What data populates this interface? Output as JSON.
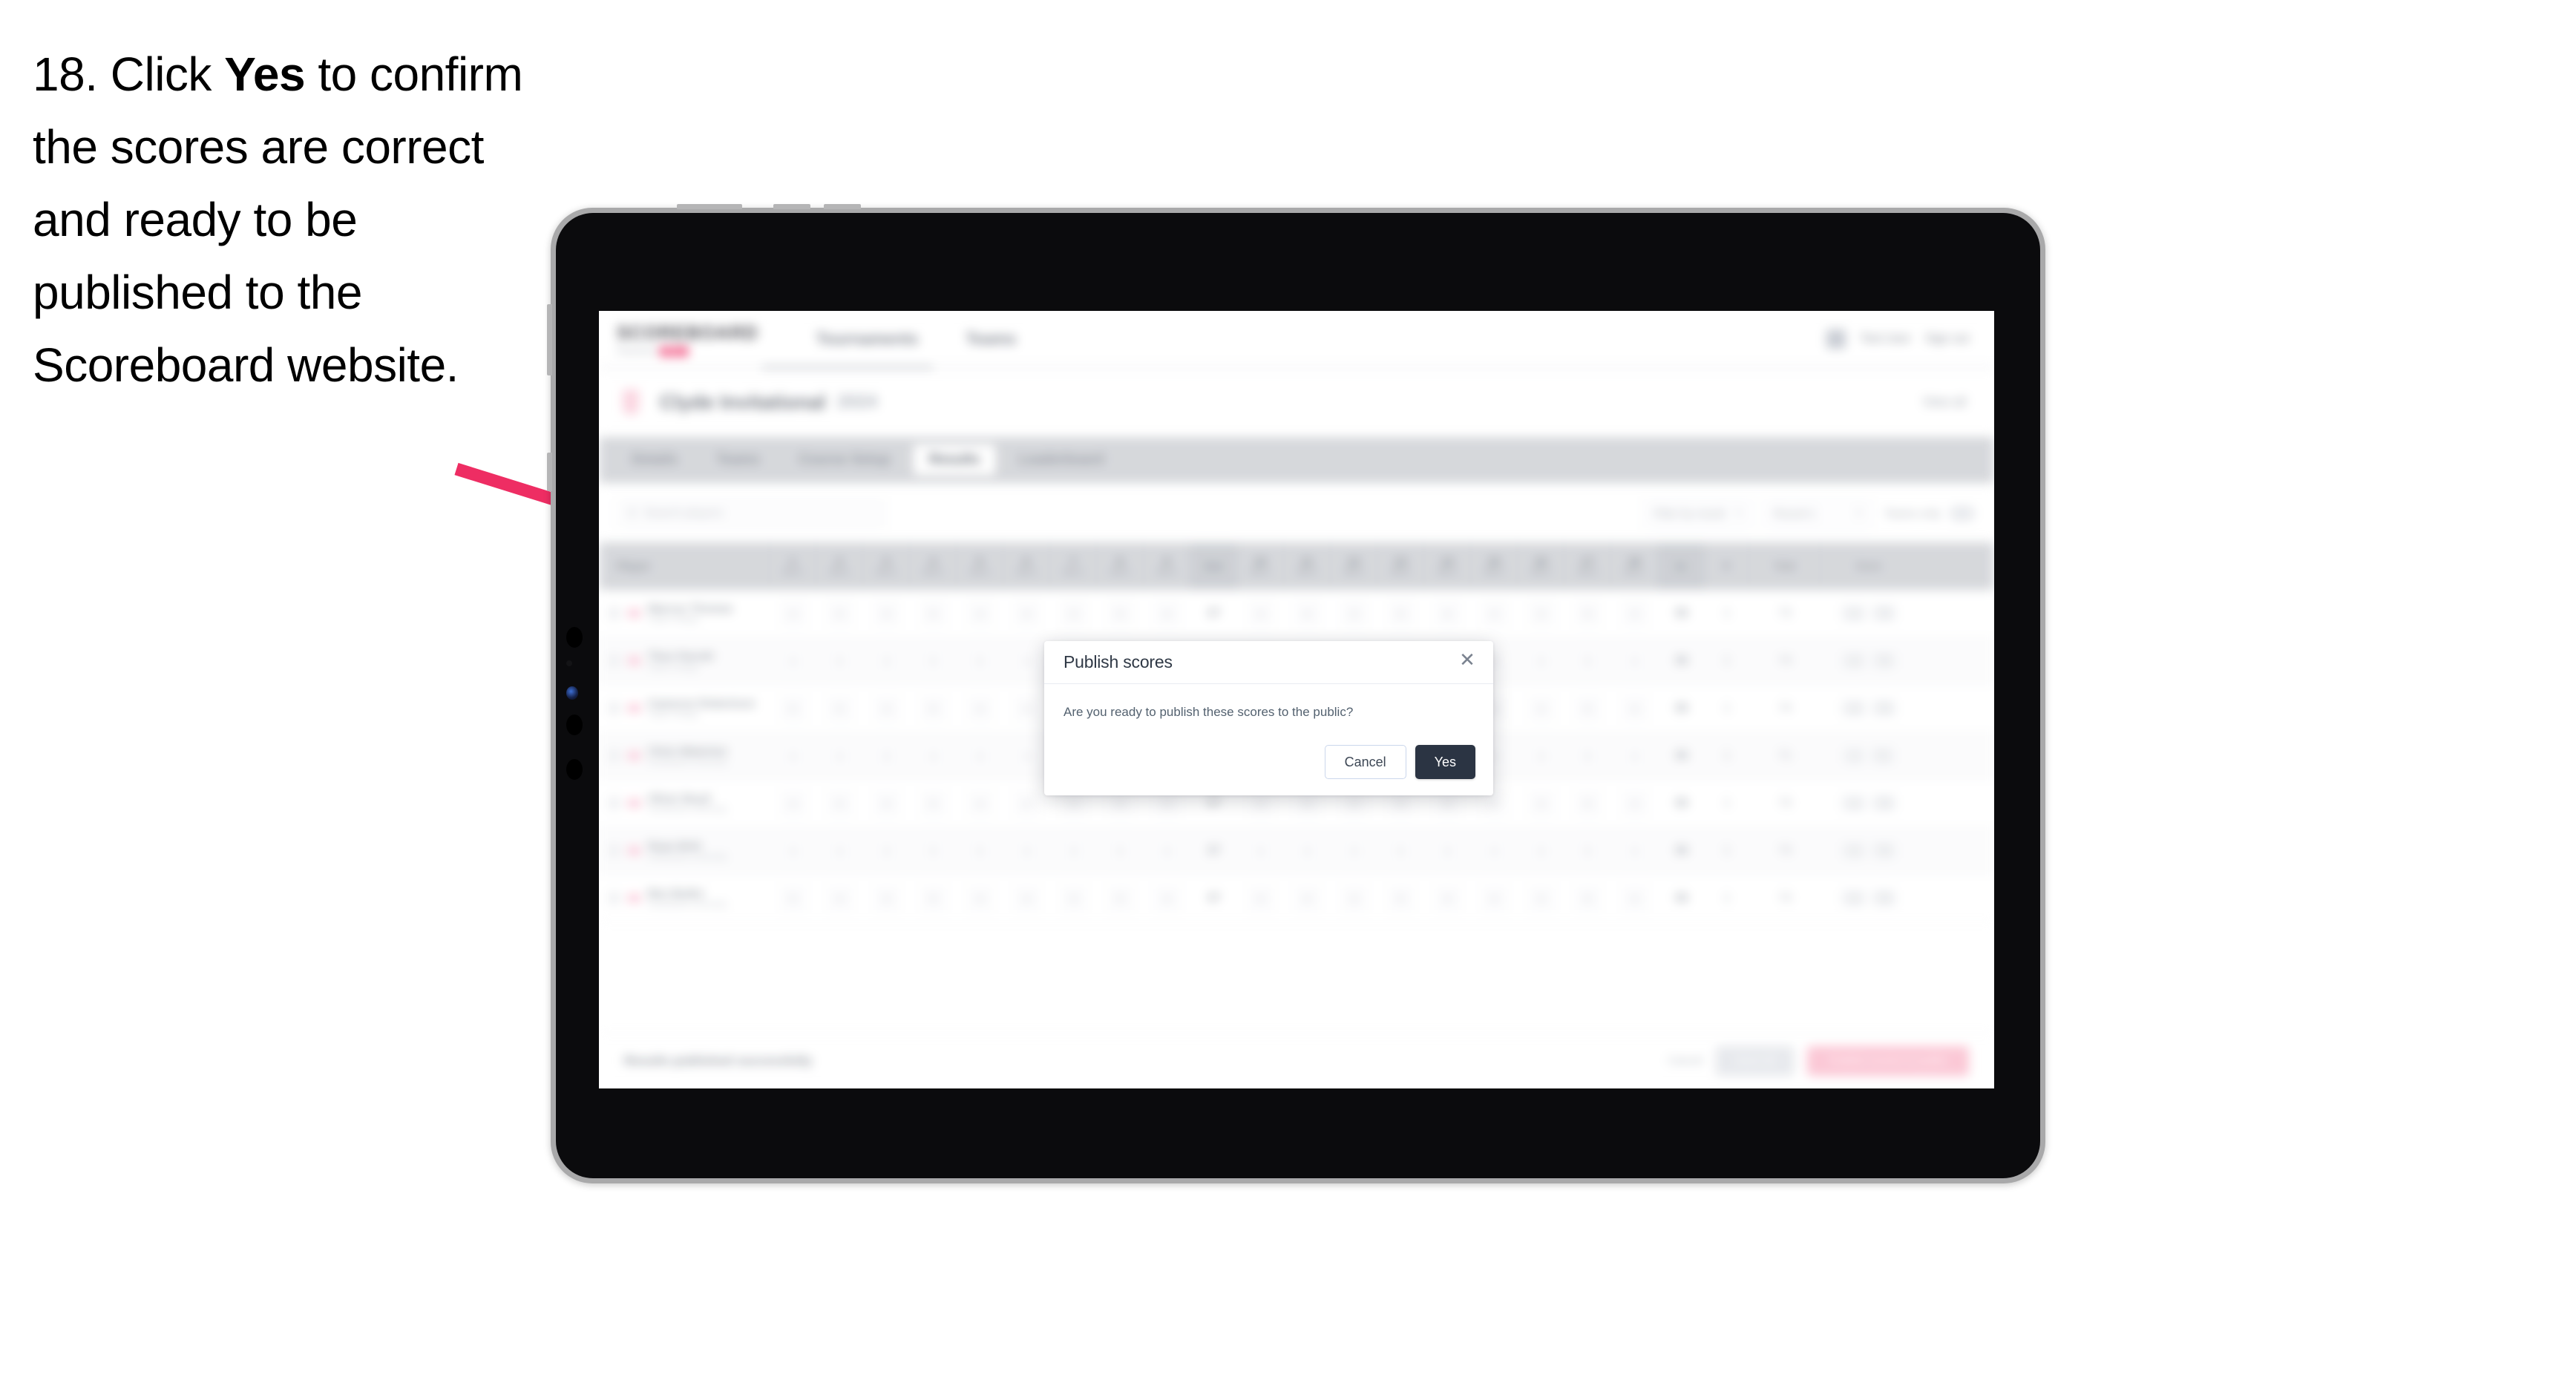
{
  "instruction": {
    "number": "18.",
    "text_before": " Click ",
    "bold_word": "Yes",
    "text_after": " to confirm the scores are correct and ready to be published to the Scoreboard website."
  },
  "colors": {
    "arrow_pink": "#ee2d63",
    "modal_primary": "#2b3443",
    "modal_cancel_border": "#cbd7ec",
    "brand_pink": "#f03a6e",
    "bezel_silver": "#a9a9aa",
    "tablet_black": "#0b0b0d"
  },
  "app": {
    "brand": {
      "name": "SCOREBOARD",
      "sub_label": "Powered by",
      "sub_pill": "GOLF"
    },
    "nav": [
      "Tournaments",
      "Teams"
    ],
    "user": {
      "name": "Test User",
      "signout": "Sign out"
    },
    "event": {
      "title": "Clyde Invitational",
      "year": "2024",
      "link": "View all"
    },
    "tabs": [
      {
        "label": "Details",
        "active": false
      },
      {
        "label": "Teams",
        "active": false
      },
      {
        "label": "Course Setup",
        "active": false
      },
      {
        "label": "Results",
        "active": true
      },
      {
        "label": "Leaderboard",
        "active": false
      }
    ],
    "filters": {
      "search_placeholder": "Search players",
      "select_round": "Filter by round",
      "select_view": "Round 1",
      "toggle_label": "Teams only"
    },
    "table": {
      "headers": {
        "player": "Player",
        "holes": [
          {
            "num": "1",
            "par": "Par 4"
          },
          {
            "num": "2",
            "par": "Par 4"
          },
          {
            "num": "3",
            "par": "Par 3"
          },
          {
            "num": "4",
            "par": "Par 5"
          },
          {
            "num": "5",
            "par": "Par 4"
          },
          {
            "num": "6",
            "par": "Par 4"
          },
          {
            "num": "7",
            "par": "Par 3"
          },
          {
            "num": "8",
            "par": "Par 5"
          },
          {
            "num": "9",
            "par": "Par 4"
          }
        ],
        "out": "Out",
        "holes_back": [
          {
            "num": "10",
            "par": "Par 4"
          },
          {
            "num": "11",
            "par": "Par 4"
          },
          {
            "num": "12",
            "par": "Par 3"
          },
          {
            "num": "13",
            "par": "Par 5"
          },
          {
            "num": "14",
            "par": "Par 4"
          },
          {
            "num": "15",
            "par": "Par 4"
          },
          {
            "num": "16",
            "par": "Par 3"
          },
          {
            "num": "17",
            "par": "Par 5"
          },
          {
            "num": "18",
            "par": "Par 4"
          }
        ],
        "in": "In",
        "r": "R",
        "total": "Total",
        "score": "Score"
      },
      "rows": [
        {
          "name": "Marcus Thomas",
          "club": "Clyde College",
          "front": [
            "4",
            "5",
            "3",
            "5",
            "4",
            "4",
            "3",
            "5",
            "4"
          ],
          "out": "37",
          "back": [
            "4",
            "4",
            "3",
            "5",
            "4",
            "4",
            "3",
            "5",
            "4"
          ],
          "in": "36",
          "r": "1",
          "total": "73",
          "score_a": "+1",
          "score_b": "73"
        },
        {
          "name": "Theo Parratt",
          "club": "Clyde College",
          "front": [
            "4",
            "5",
            "3",
            "5",
            "5",
            "4",
            "3",
            "5",
            "4"
          ],
          "out": "38",
          "back": [
            "4",
            "4",
            "3",
            "5",
            "4",
            "4",
            "3",
            "5",
            "4"
          ],
          "in": "36",
          "r": "1",
          "total": "74",
          "score_a": "+2",
          "score_b": "74"
        },
        {
          "name": "Cameron Robertson",
          "club": "Clyde College",
          "front": [
            "5",
            "5",
            "3",
            "5",
            "4",
            "4",
            "3",
            "5",
            "4"
          ],
          "out": "38",
          "back": [
            "4",
            "4",
            "3",
            "5",
            "4",
            "4",
            "3",
            "5",
            "4"
          ],
          "in": "36",
          "r": "1",
          "total": "74",
          "score_a": "+2",
          "score_b": "74"
        },
        {
          "name": "Chris Waterton",
          "club": "Southlands University",
          "front": [
            "4",
            "4",
            "3",
            "4",
            "4",
            "4",
            "3",
            "5",
            "4"
          ],
          "out": "35",
          "back": [
            "4",
            "4",
            "3",
            "5",
            "4",
            "4",
            "3",
            "5",
            "4"
          ],
          "in": "36",
          "r": "1",
          "total": "71",
          "score_a": "-1",
          "score_b": "71"
        },
        {
          "name": "Oliver Boyd",
          "club": "Southlands University",
          "front": [
            "4",
            "5",
            "3",
            "5",
            "4",
            "4",
            "3",
            "5",
            "4"
          ],
          "out": "37",
          "back": [
            "4",
            "4",
            "3",
            "5",
            "4",
            "4",
            "3",
            "5",
            "4"
          ],
          "in": "36",
          "r": "1",
          "total": "73",
          "score_a": "+1",
          "score_b": "73"
        },
        {
          "name": "Ryan Britt",
          "club": "Southlands University",
          "front": [
            "4",
            "4",
            "3",
            "5",
            "5",
            "4",
            "3",
            "5",
            "4"
          ],
          "out": "37",
          "back": [
            "4",
            "4",
            "3",
            "5",
            "4",
            "4",
            "3",
            "5",
            "4"
          ],
          "in": "36",
          "r": "1",
          "total": "73",
          "score_a": "+1",
          "score_b": "73"
        },
        {
          "name": "Ben Butler",
          "club": "Southlands University",
          "front": [
            "5",
            "4",
            "3",
            "5",
            "4",
            "4",
            "3",
            "5",
            "4"
          ],
          "out": "37",
          "back": [
            "4",
            "4",
            "3",
            "5",
            "4",
            "4",
            "3",
            "5",
            "4"
          ],
          "in": "36",
          "r": "1",
          "total": "73",
          "score_a": "+1",
          "score_b": "73"
        }
      ]
    },
    "bottom": {
      "status": "Results published successfully",
      "link": "Cancel",
      "btn_gray": "Save all",
      "btn_pink": "Publish scores to public"
    }
  },
  "modal": {
    "title": "Publish scores",
    "close_icon": "close-icon",
    "body": "Are you ready to publish these scores to the public?",
    "cancel_label": "Cancel",
    "confirm_label": "Yes"
  }
}
